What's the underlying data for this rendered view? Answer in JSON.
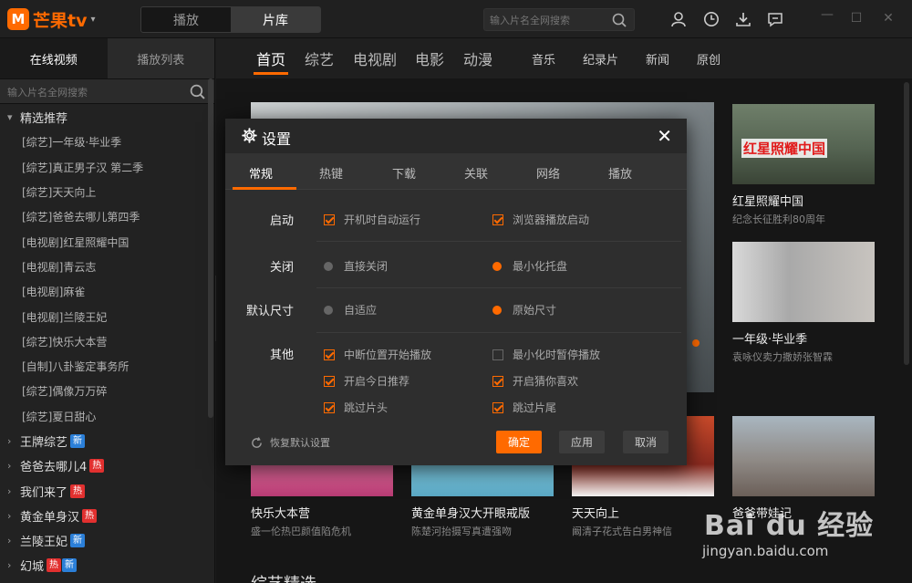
{
  "app": {
    "logo_mark": "M",
    "name": "芒果tv",
    "caret": "▾",
    "mode_tabs": [
      "播放",
      "片库"
    ],
    "active_mode": 1,
    "search_placeholder": "输入片名全网搜索"
  },
  "sidebar": {
    "tabs": [
      "在线视频",
      "播放列表"
    ],
    "search_placeholder": "输入片名全网搜索",
    "featured": {
      "label": "精选推荐",
      "items": [
        "[综艺]一年级·毕业季",
        "[综艺]真正男子汉 第二季",
        "[综艺]天天向上",
        "[综艺]爸爸去哪儿第四季",
        "[电视剧]红星照耀中国",
        "[电视剧]青云志",
        "[电视剧]麻雀",
        "[电视剧]兰陵王妃",
        "[综艺]快乐大本营",
        "[自制]八卦鉴定事务所",
        "[综艺]偶像万万碎",
        "[综艺]夏日甜心"
      ]
    },
    "groups": [
      {
        "label": "王牌综艺",
        "badges": [
          "新"
        ]
      },
      {
        "label": "爸爸去哪儿4",
        "badges": [
          "热"
        ]
      },
      {
        "label": "我们来了",
        "badges": [
          "热"
        ]
      },
      {
        "label": "黄金单身汉",
        "badges": [
          "热"
        ]
      },
      {
        "label": "兰陵王妃",
        "badges": [
          "新"
        ]
      },
      {
        "label": "幻城",
        "badges": [
          "热",
          "新"
        ]
      }
    ]
  },
  "nav": {
    "primary": [
      "首页",
      "综艺",
      "电视剧",
      "电影",
      "动漫"
    ],
    "secondary": [
      "音乐",
      "纪录片",
      "新闻",
      "原创"
    ]
  },
  "cards": [
    {
      "title": "红星照耀中国",
      "sub": "纪念长征胜利80周年",
      "poster_text": "红星照耀中国"
    },
    {
      "title": "一年级·毕业季",
      "sub": "袁咏仪卖力撒娇张智霖"
    },
    {
      "title": "快乐大本营",
      "sub": "盛一伦热巴颜值陷危机"
    },
    {
      "title": "黄金单身汉大开眼戒版",
      "sub": "陈楚河抬摄写真遭强吻"
    },
    {
      "title": "天天向上",
      "sub": "阚清子花式告白男神信"
    },
    {
      "title": "爸爸带娃记",
      "sub": ""
    }
  ],
  "section_peek": "综艺精选",
  "dialog": {
    "title": "设置",
    "close": "✕",
    "tabs": [
      "常规",
      "热键",
      "下载",
      "关联",
      "网络",
      "播放"
    ],
    "sections": {
      "startup": {
        "label": "启动",
        "opt1": "开机时自动运行",
        "opt2": "浏览器播放启动"
      },
      "close": {
        "label": "关闭",
        "opt1": "直接关闭",
        "opt2": "最小化托盘"
      },
      "size": {
        "label": "默认尺寸",
        "opt1": "自适应",
        "opt2": "原始尺寸"
      },
      "other": {
        "label": "其他",
        "opt1": "中断位置开始播放",
        "opt2": "最小化时暂停播放",
        "opt3": "开启今日推荐",
        "opt4": "开启猜你喜欢",
        "opt5": "跳过片头",
        "opt6": "跳过片尾"
      }
    },
    "reset": "恢复默认设置",
    "buttons": {
      "ok": "确定",
      "apply": "应用",
      "cancel": "取消"
    }
  },
  "watermark": {
    "brand": "Bai du 经验",
    "url": "jingyan.baidu.com"
  },
  "colors": {
    "accent": "#ff6a00",
    "new_badge": "#2b7fd8",
    "hot_badge": "#e2302f"
  }
}
